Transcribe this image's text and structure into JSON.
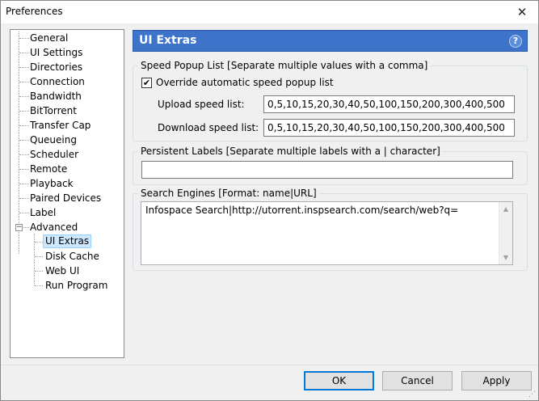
{
  "window": {
    "title": "Preferences"
  },
  "nav": {
    "items": [
      {
        "label": "General"
      },
      {
        "label": "UI Settings"
      },
      {
        "label": "Directories"
      },
      {
        "label": "Connection"
      },
      {
        "label": "Bandwidth"
      },
      {
        "label": "BitTorrent"
      },
      {
        "label": "Transfer Cap"
      },
      {
        "label": "Queueing"
      },
      {
        "label": "Scheduler"
      },
      {
        "label": "Remote"
      },
      {
        "label": "Playback"
      },
      {
        "label": "Paired Devices"
      },
      {
        "label": "Label"
      },
      {
        "label": "Advanced"
      }
    ],
    "advanced_children": [
      {
        "label": "UI Extras",
        "selected": true
      },
      {
        "label": "Disk Cache"
      },
      {
        "label": "Web UI"
      },
      {
        "label": "Run Program"
      }
    ]
  },
  "panel": {
    "title": "UI Extras",
    "help": "?"
  },
  "speed_popup": {
    "group_label": "Speed Popup List [Separate multiple values with a comma]",
    "override_label": "Override automatic speed popup list",
    "override_checked": true,
    "check_mark": "✔",
    "upload_label": "Upload speed list:",
    "upload_value": "0,5,10,15,20,30,40,50,100,150,200,300,400,500",
    "download_label": "Download speed list:",
    "download_value": "0,5,10,15,20,30,40,50,100,150,200,300,400,500"
  },
  "persistent_labels": {
    "group_label": "Persistent Labels [Separate multiple labels with a | character]",
    "value": ""
  },
  "search_engines": {
    "group_label": "Search Engines [Format: name|URL]",
    "value": "Infospace Search|http://utorrent.inspsearch.com/search/web?q="
  },
  "buttons": {
    "ok": "OK",
    "cancel": "Cancel",
    "apply": "Apply"
  }
}
